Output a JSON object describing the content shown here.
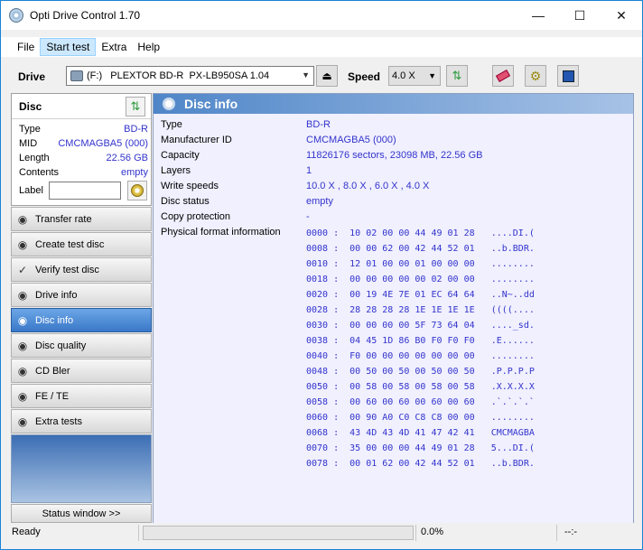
{
  "window": {
    "title": "Opti Drive Control 1.70"
  },
  "menu": [
    "File",
    "Start test",
    "Extra",
    "Help"
  ],
  "toolbar": {
    "drive_label": "Drive",
    "drive_value": "(F:)   PLEXTOR BD-R  PX-LB950SA 1.04",
    "speed_label": "Speed",
    "speed_value": "4.0 X"
  },
  "disc": {
    "header": "Disc",
    "rows": [
      {
        "k": "Type",
        "v": "BD-R"
      },
      {
        "k": "MID",
        "v": "CMCMAGBA5 (000)"
      },
      {
        "k": "Length",
        "v": "22.56 GB"
      },
      {
        "k": "Contents",
        "v": "empty"
      }
    ],
    "label_text": "Label"
  },
  "nav": [
    {
      "label": "Transfer rate",
      "icon": "transfer-rate-icon"
    },
    {
      "label": "Create test disc",
      "icon": "create-test-disc-icon"
    },
    {
      "label": "Verify test disc",
      "icon": "verify-test-disc-icon"
    },
    {
      "label": "Drive info",
      "icon": "drive-info-icon"
    },
    {
      "label": "Disc info",
      "icon": "disc-info-icon",
      "active": true
    },
    {
      "label": "Disc quality",
      "icon": "disc-quality-icon"
    },
    {
      "label": "CD Bler",
      "icon": "cd-bler-icon"
    },
    {
      "label": "FE / TE",
      "icon": "fe-te-icon"
    },
    {
      "label": "Extra tests",
      "icon": "extra-tests-icon"
    }
  ],
  "status_window_label": "Status window >>",
  "discinfo": {
    "title": "Disc info",
    "rows": [
      {
        "k": "Type",
        "v": "BD-R"
      },
      {
        "k": "Manufacturer ID",
        "v": "CMCMAGBA5 (000)"
      },
      {
        "k": "Capacity",
        "v": "11826176 sectors, 23098 MB, 22.56 GB"
      },
      {
        "k": "Layers",
        "v": "1"
      },
      {
        "k": "Write speeds",
        "v": "10.0 X , 8.0 X , 6.0 X , 4.0 X"
      },
      {
        "k": "Disc status",
        "v": "empty"
      },
      {
        "k": "Copy protection",
        "v": "-"
      },
      {
        "k": "Physical format information",
        "v": ""
      }
    ],
    "hex": [
      "0000 :  10 02 00 00 44 49 01 28   ....DI.(",
      "0008 :  00 00 62 00 42 44 52 01   ..b.BDR.",
      "0010 :  12 01 00 00 01 00 00 00   ........",
      "0018 :  00 00 00 00 00 02 00 00   ........",
      "0020 :  00 19 4E 7E 01 EC 64 64   ..N~..dd",
      "0028 :  28 28 28 28 1E 1E 1E 1E   ((((....",
      "0030 :  00 00 00 00 5F 73 64 04   ...._sd.",
      "0038 :  04 45 1D 86 B0 F0 F0 F0   .E......",
      "0040 :  F0 00 00 00 00 00 00 00   ........",
      "0048 :  00 50 00 50 00 50 00 50   .P.P.P.P",
      "0050 :  00 58 00 58 00 58 00 58   .X.X.X.X",
      "0058 :  00 60 00 60 00 60 00 60   .`.`.`.`",
      "0060 :  00 90 A0 C0 C8 C8 00 00   ........",
      "0068 :  43 4D 43 4D 41 47 42 41   CMCMAGBA",
      "0070 :  35 00 00 00 44 49 01 28   5...DI.(",
      "0078 :  00 01 62 00 42 44 52 01   ..b.BDR."
    ]
  },
  "status": {
    "ready": "Ready",
    "progress_pct": "0.0%",
    "progress": 0,
    "time": "--:-"
  }
}
